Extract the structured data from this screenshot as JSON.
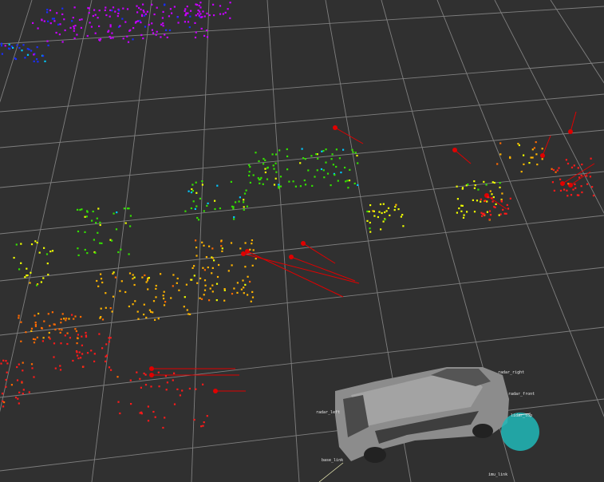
{
  "viewport": {
    "background": "#303030",
    "grid_color": "#9a9a9a"
  },
  "frame_labels": [
    "base_link",
    "radar_front",
    "radar_left",
    "radar_right",
    "lidar_top",
    "imu_link"
  ],
  "point_cloud": {
    "color_scale": [
      "#ff1a1a",
      "#ff6a00",
      "#ffb400",
      "#f0ff00",
      "#33e000",
      "#00c8ff",
      "#1a2dff",
      "#c800ff"
    ]
  },
  "ego_vehicle": {
    "body_color": "#8a8a8a",
    "marker_color": "#20b8b8"
  },
  "tracks": {
    "color": "#e00000"
  }
}
